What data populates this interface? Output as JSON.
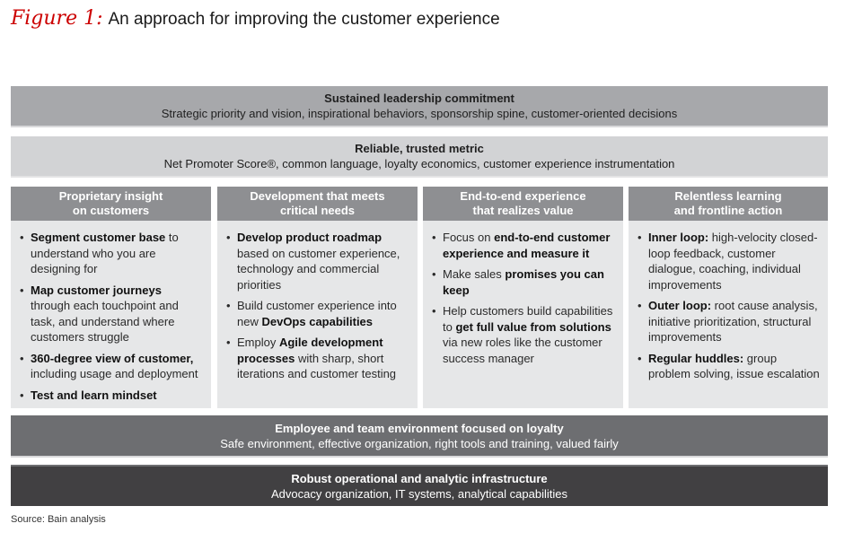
{
  "title": {
    "figure_label": "Figure 1:",
    "text": "An approach for improving the customer experience"
  },
  "bands": {
    "leadership": {
      "heading": "Sustained leadership commitment",
      "sub": "Strategic priority and vision, inspirational behaviors, sponsorship spine, customer-oriented decisions",
      "color": "#a7a8ab"
    },
    "metric": {
      "heading": "Reliable, trusted metric",
      "sub": "Net Promoter Score®, common language, loyalty economics, customer experience instrumentation",
      "color": "#d2d3d5"
    },
    "employee": {
      "heading": "Employee and team environment focused on loyalty",
      "sub": "Safe environment, effective organization, right tools and training, valued fairly",
      "color": "#6d6e71"
    },
    "infra": {
      "heading": "Robust operational and analytic infrastructure",
      "sub": "Advocacy organization, IT systems, analytical capabilities",
      "color": "#414042"
    }
  },
  "columns": [
    {
      "header": [
        "Proprietary insight",
        "on customers"
      ],
      "items": [
        [
          {
            "b": "Segment customer base"
          },
          {
            "t": " to understand who you are designing for"
          }
        ],
        [
          {
            "b": "Map customer journeys"
          },
          {
            "t": " through each touchpoint and task, and understand where customers struggle"
          }
        ],
        [
          {
            "b": "360-degree view of customer,"
          },
          {
            "t": " including usage and deployment"
          }
        ],
        [
          {
            "b": "Test and learn mindset"
          }
        ]
      ]
    },
    {
      "header": [
        "Development that meets",
        "critical needs"
      ],
      "items": [
        [
          {
            "b": "Develop product roadmap"
          },
          {
            "t": " based on customer experience, technology and commercial priorities"
          }
        ],
        [
          {
            "t": "Build customer experience into new "
          },
          {
            "b": "DevOps capabilities"
          }
        ],
        [
          {
            "t": "Employ "
          },
          {
            "b": "Agile development processes"
          },
          {
            "t": " with sharp, short iterations and customer testing"
          }
        ]
      ]
    },
    {
      "header": [
        "End-to-end experience",
        "that realizes value"
      ],
      "items": [
        [
          {
            "t": "Focus on "
          },
          {
            "b": "end-to-end customer experience and measure it"
          }
        ],
        [
          {
            "t": "Make sales "
          },
          {
            "b": "promises you can keep"
          }
        ],
        [
          {
            "t": "Help customers build capabilities to "
          },
          {
            "b": "get full value from solutions"
          },
          {
            "t": " via new roles like the customer success manager"
          }
        ]
      ]
    },
    {
      "header": [
        "Relentless learning",
        "and frontline action"
      ],
      "items": [
        [
          {
            "b": "Inner loop:"
          },
          {
            "t": " high-velocity closed-loop feedback, customer dialogue, coaching, individual improvements"
          }
        ],
        [
          {
            "b": "Outer loop:"
          },
          {
            "t": " root cause analysis, initiative prioritization, structural improvements"
          }
        ],
        [
          {
            "b": "Regular huddles:"
          },
          {
            "t": " group problem solving, issue escalation"
          }
        ]
      ]
    }
  ],
  "bullet_glyph": "•",
  "source": "Source: Bain analysis",
  "colors": {
    "figure_label": "#cc0000",
    "column_header": "#8e8f92",
    "column_body": "#e6e7e8"
  }
}
